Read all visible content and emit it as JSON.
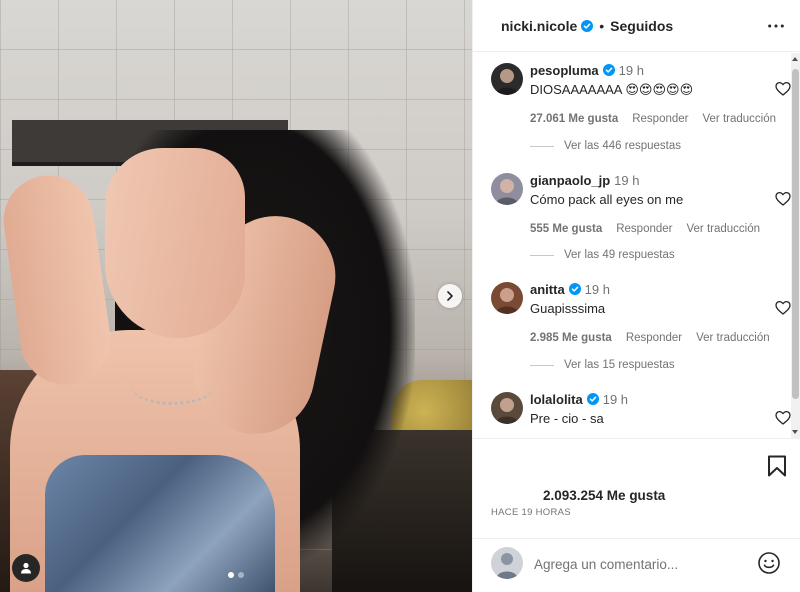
{
  "post": {
    "carousel": {
      "slide_count": 2,
      "active_index": 0
    }
  },
  "header": {
    "username": "nicki.nicole",
    "separator": "•",
    "follow_status": "Seguidos"
  },
  "comments": [
    {
      "username": "pesopluma",
      "verified": true,
      "time": "19 h",
      "text": "DIOSAAAAAAA 😍😍😍😍😍",
      "likes": "27.061 Me gusta",
      "reply_label": "Responder",
      "translate_label": "Ver traducción",
      "view_replies": "Ver las 446 respuestas",
      "avatar_color": "#2b2b2b"
    },
    {
      "username": "gianpaolo_jp",
      "verified": false,
      "time": "19 h",
      "text": "Cómo pack all eyes on me",
      "likes": "555 Me gusta",
      "reply_label": "Responder",
      "translate_label": "Ver traducción",
      "view_replies": "Ver las 49 respuestas",
      "avatar_color": "#8e8e9e"
    },
    {
      "username": "anitta",
      "verified": true,
      "time": "19 h",
      "text": "Guapisssima",
      "likes": "2.985 Me gusta",
      "reply_label": "Responder",
      "translate_label": "Ver traducción",
      "view_replies": "Ver las 15 respuestas",
      "avatar_color": "#7a4a35"
    },
    {
      "username": "lolalolita",
      "verified": true,
      "time": "19 h",
      "text": "Pre - cio - sa",
      "avatar_color": "#5a4a3c"
    }
  ],
  "actions": {
    "total_likes": "2.093.254 Me gusta",
    "posted_time": "HACE 19 HORAS"
  },
  "add_comment": {
    "placeholder": "Agrega un comentario..."
  },
  "colors": {
    "verified": "#0095f6",
    "muted_text": "#737373",
    "border": "#efefef"
  },
  "icons": {
    "verified": "verified-badge-icon",
    "more": "more-options-icon",
    "heart": "heart-outline-icon",
    "bookmark": "bookmark-icon",
    "emoji": "emoji-smile-icon",
    "next": "chevron-right-icon",
    "tag": "user-tag-icon"
  }
}
